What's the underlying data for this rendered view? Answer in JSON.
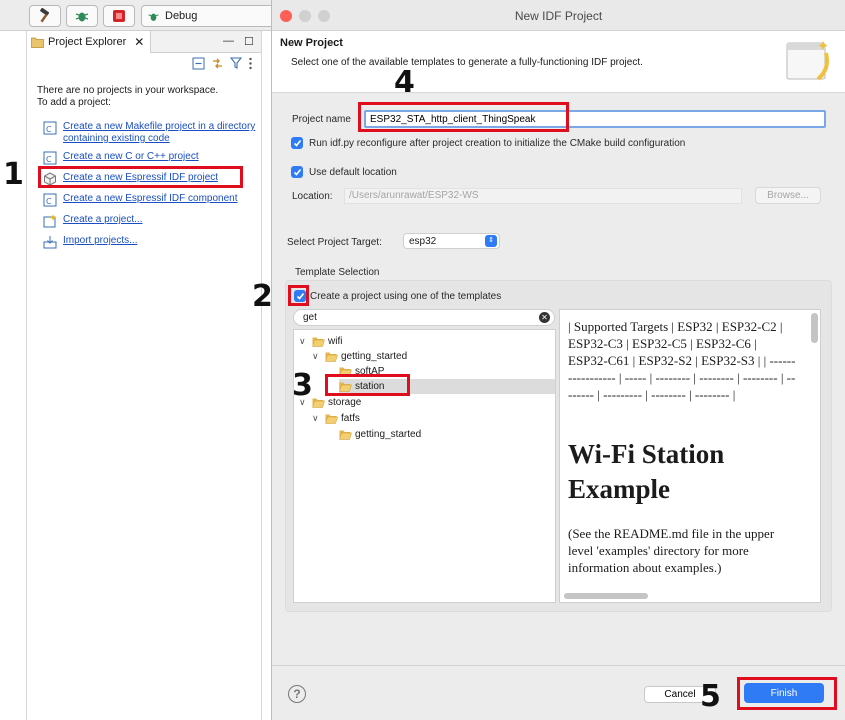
{
  "ide": {
    "toolbar": {
      "debug_label": "Debug"
    },
    "explorer": {
      "tab_label": "Project Explorer",
      "empty_message": "There are no projects in your workspace.\nTo add a project:",
      "links": [
        {
          "label": "Create a new Makefile project in a directory containing existing code",
          "icon": "makefile-project-icon"
        },
        {
          "label": "Create a new C or C++ project",
          "icon": "c-project-icon"
        },
        {
          "label": "Create a new Espressif IDF project",
          "icon": "espressif-project-icon"
        },
        {
          "label": "Create a new Espressif IDF component",
          "icon": "espressif-component-icon"
        },
        {
          "label": "Create a project...",
          "icon": "new-project-icon"
        },
        {
          "label": "Import projects...",
          "icon": "import-icon"
        }
      ]
    }
  },
  "dialog": {
    "title": "New IDF Project",
    "header": {
      "title": "New Project",
      "description": "Select one of the available templates to generate a fully-functioning IDF project."
    },
    "project_name_label": "Project name",
    "project_name_value": "ESP32_STA_http_client_ThingSpeak",
    "reconfigure_label": "Run idf.py reconfigure after project creation to initialize the CMake build configuration",
    "reconfigure_checked": true,
    "default_location_label": "Use default location",
    "default_location_checked": true,
    "location_label": "Location:",
    "location_value": "/Users/arunrawat/ESP32-WS",
    "browse_label": "Browse...",
    "target_label": "Select Project Target:",
    "target_value": "esp32",
    "template_group_label": "Template Selection",
    "use_template_label": "Create a project using one of the templates",
    "use_template_checked": true,
    "search_value": "get",
    "tree": {
      "wifi": "wifi",
      "getting_started": "getting_started",
      "softap": "softAP",
      "station": "station",
      "storage": "storage",
      "fatfs": "fatfs",
      "fatfs_getting_started": "getting_started"
    },
    "readme": {
      "table_text": "| Supported Targets | ESP32 | ESP32-C2 | ESP32-C3 | ESP32-C5 | ESP32-C6 | ESP32-C61 | ESP32-S2 | ESP32-S3 | | ----------------- | ----- | -------- | -------- | -------- | -------- | --------- | -------- | -------- |",
      "heading": "Wi-Fi Station Example",
      "paragraph": "(See the README.md file in the upper level 'examples' directory for more information about examples.)"
    },
    "cancel_label": "Cancel",
    "finish_label": "Finish",
    "help_label": "?"
  },
  "annotations": {
    "step1": "1",
    "step2": "2",
    "step3": "3",
    "step4": "4",
    "step5": "5"
  },
  "colors": {
    "accent": "#2f7bf6",
    "highlight": "#e00d1f",
    "link": "#1a4fc4"
  }
}
